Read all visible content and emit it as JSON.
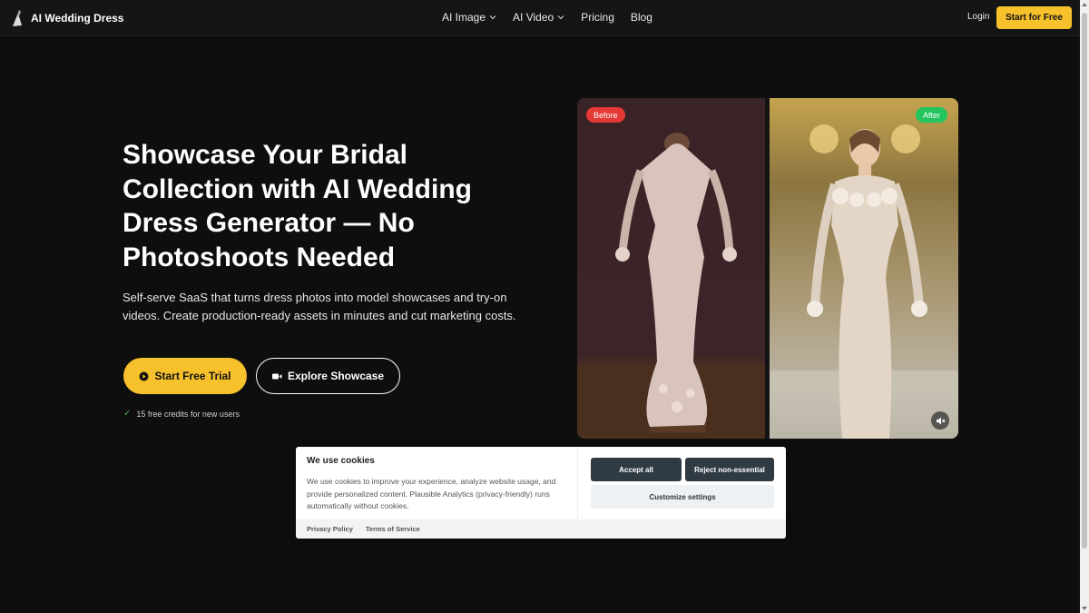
{
  "header": {
    "brand": "AI Wedding Dress",
    "nav": [
      {
        "label": "AI Image",
        "dropdown": true
      },
      {
        "label": "AI Video",
        "dropdown": true
      },
      {
        "label": "Pricing",
        "dropdown": false
      },
      {
        "label": "Blog",
        "dropdown": false
      }
    ],
    "login_label": "Login",
    "cta_label": "Start for Free"
  },
  "hero": {
    "title": "Showcase Your Bridal Collection with AI Wedding Dress Generator — No Photoshoots Needed",
    "subtitle": "Self-serve SaaS that turns dress photos into model showcases and try-on videos. Create production-ready assets in minutes and cut marketing costs.",
    "primary_button": "Start Free Trial",
    "secondary_button": "Explore Showcase",
    "credits_note": "15 free credits for new users"
  },
  "compare": {
    "before_label": "Before",
    "after_label": "After"
  },
  "cookie": {
    "title": "We use cookies",
    "text": "We use cookies to improve your experience, analyze website usage, and provide personalized content. Plausible Analytics (privacy-friendly) runs automatically without cookies.",
    "accept_label": "Accept all",
    "reject_label": "Reject non-essential",
    "customize_label": "Customize settings",
    "links": [
      "Privacy Policy",
      "Terms of Service"
    ]
  },
  "colors": {
    "accent": "#f7c12c",
    "background": "#0e0e0e",
    "before_badge": "#e53935",
    "after_badge": "#22c55e"
  },
  "icons": [
    "logo-icon",
    "chevron-down-icon",
    "play-icon",
    "video-icon",
    "check-icon",
    "mute-icon"
  ]
}
